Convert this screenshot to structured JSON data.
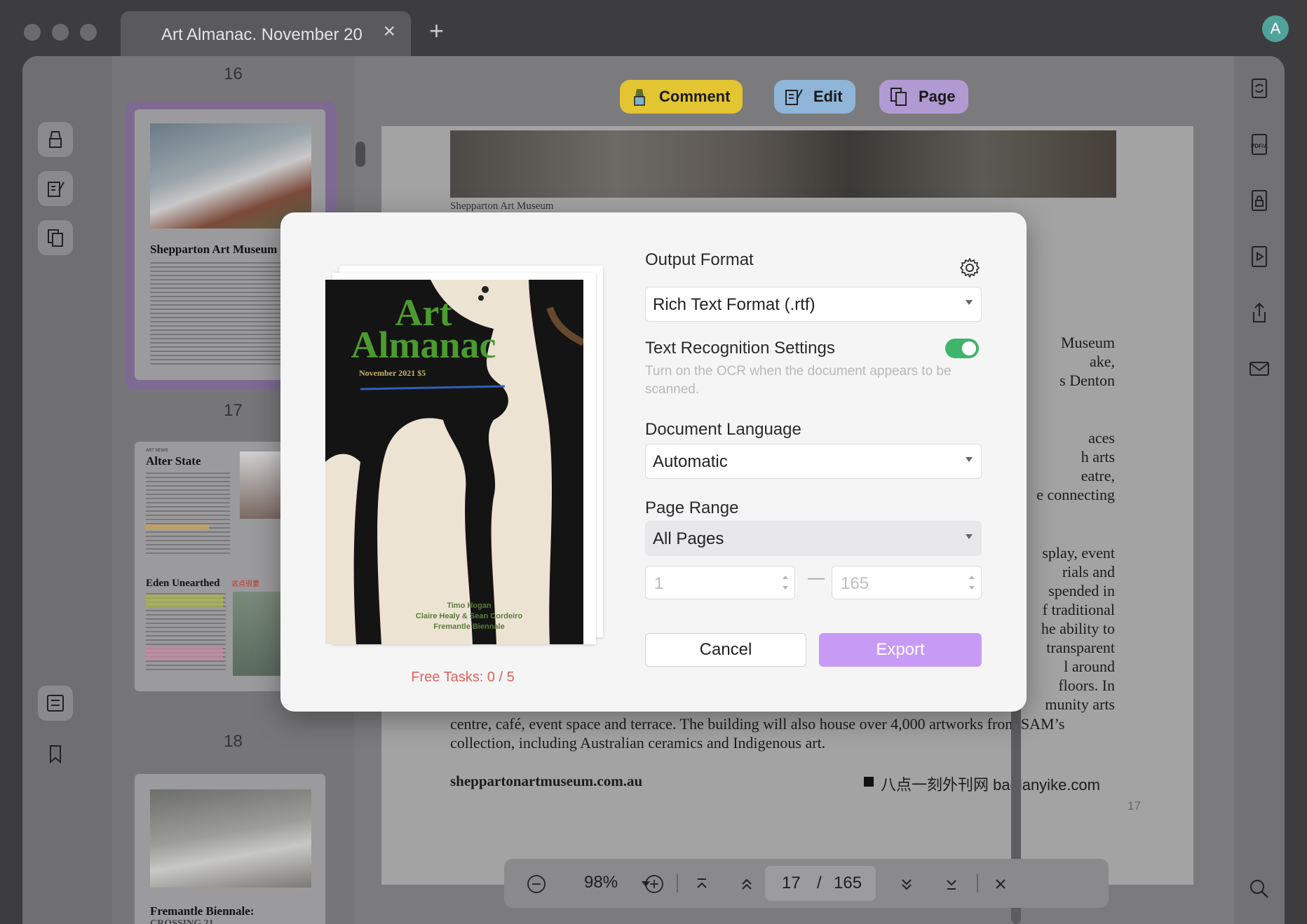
{
  "tab": {
    "title": "Art Almanac. November 20",
    "avatar_letter": "A"
  },
  "modes": [
    {
      "label": "Comment",
      "color": "#e2c530"
    },
    {
      "label": "Edit",
      "color": "#8fb5d8"
    },
    {
      "label": "Page",
      "color": "#b19ad2"
    }
  ],
  "thumbnails": {
    "page_numbers": [
      "16",
      "17",
      "18"
    ],
    "p16_heading": "Shepparton Art Museum",
    "p17_heading_1": "Alter State",
    "p17_heading_2": "Eden Unearthed",
    "p17_kicker": "ART NEWS",
    "p17_annotation": "这点很重",
    "p18_heading": "Fremantle Biennale:",
    "p18_sub": "CROSSING 21"
  },
  "document": {
    "photo_caption": "Shepparton Art Museum",
    "right_fragments": [
      "Museum",
      "ake,",
      "s Denton",
      "aces",
      "h arts",
      "eatre,",
      "e connecting",
      "splay, event",
      "rials and",
      "spended in",
      "f traditional",
      "he ability to",
      "transparent",
      "l around",
      "floors. In",
      "munity arts"
    ],
    "body_line_1": "centre, café, event space and terrace. The building will also house over 4,000 artworks from SAM’s",
    "body_line_2": "collection, including Australian ceramics and Indigenous art.",
    "website": "sheppartonartmuseum.com.au",
    "watermark": "八点一刻外刊网 badianyike.com",
    "page_number": "17"
  },
  "zoom_bar": {
    "zoom": "98%",
    "current_page": "17",
    "separator": "/",
    "total_pages": "165"
  },
  "dialog": {
    "output_format_label": "Output Format",
    "output_format_value": "Rich Text Format (.rtf)",
    "ocr_label": "Text Recognition Settings",
    "ocr_help": "Turn on the OCR when the document appears to be scanned.",
    "ocr_enabled": true,
    "language_label": "Document Language",
    "language_value": "Automatic",
    "page_range_label": "Page Range",
    "page_range_value": "All Pages",
    "range_from": "1",
    "range_dash": "—",
    "range_to": "165",
    "cancel_label": "Cancel",
    "export_label": "Export",
    "free_tasks": "Free Tasks: 0 / 5",
    "accent_color": "#c79af5",
    "toggle_color": "#3fb56b"
  },
  "cover": {
    "title_line_1": "Art",
    "title_line_2": "Almanac",
    "issue": "November 2021 $5",
    "credit_1": "Timo Hogan",
    "credit_2": "Claire Healy & Sean Cordeiro",
    "credit_3": "Fremantle Biennale"
  },
  "icons": {
    "left_tools": [
      "comment-tool-icon",
      "edit-tool-icon",
      "page-tool-icon",
      "form-icon",
      "bookmark-icon"
    ],
    "right_tools": [
      "convert-icon",
      "pdfa-icon",
      "protect-icon",
      "slideshow-icon",
      "share-icon",
      "mail-icon",
      "search-icon"
    ]
  }
}
